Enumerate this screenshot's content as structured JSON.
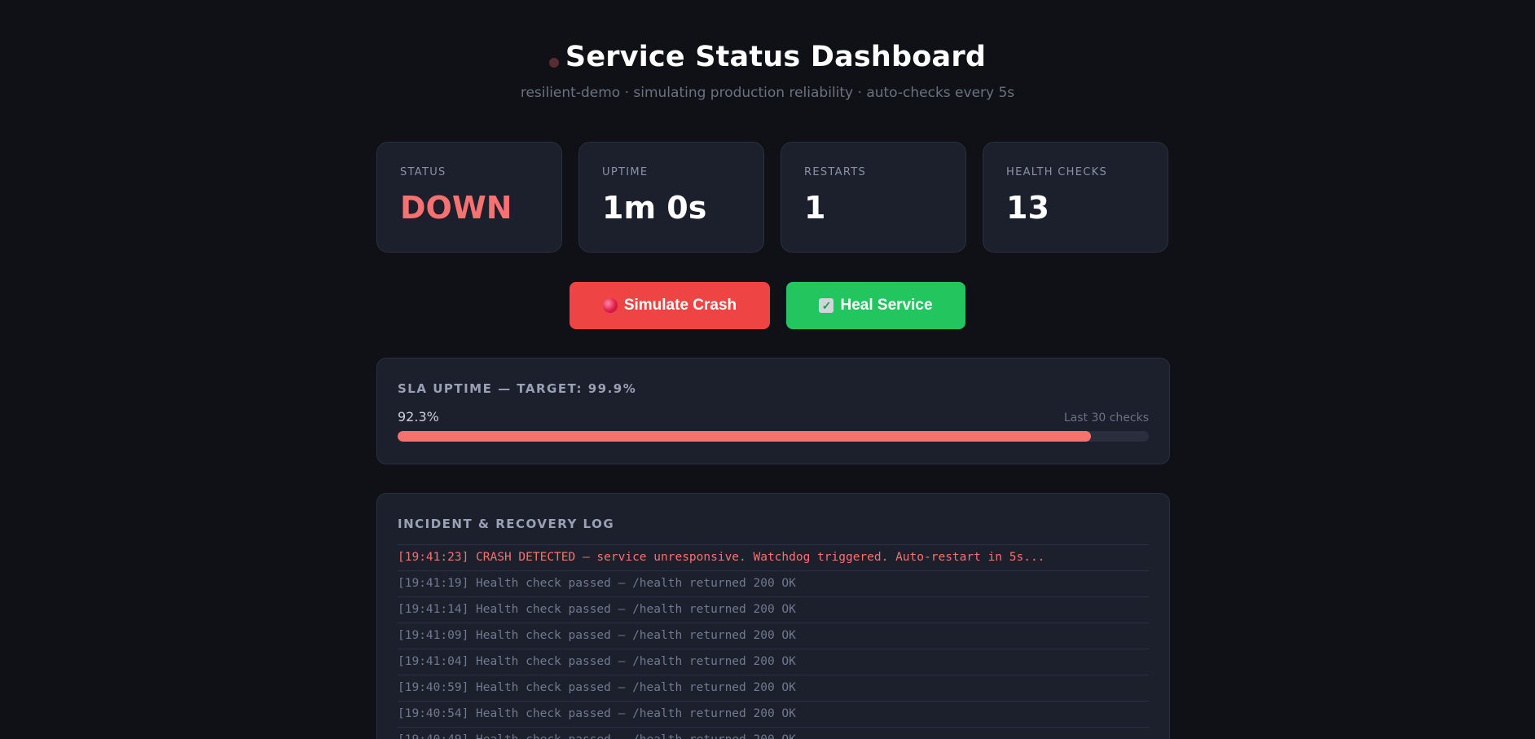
{
  "header": {
    "title": "Service Status Dashboard",
    "subtitle": "resilient-demo · simulating production reliability · auto-checks every 5s"
  },
  "stats": [
    {
      "label": "STATUS",
      "value": "DOWN"
    },
    {
      "label": "UPTIME",
      "value": "1m 0s"
    },
    {
      "label": "RESTARTS",
      "value": "1"
    },
    {
      "label": "HEALTH CHECKS",
      "value": "13"
    }
  ],
  "actions": {
    "crash_label": "Simulate Crash",
    "heal_label": "Heal Service"
  },
  "sla": {
    "title": "SLA UPTIME — TARGET: 99.9%",
    "percent_text": "92.3%",
    "percent_value": 92.3,
    "note": "Last 30 checks"
  },
  "log": {
    "title": "INCIDENT & RECOVERY LOG",
    "entries": [
      {
        "text": "[19:41:23] CRASH DETECTED — service unresponsive. Watchdog triggered. Auto-restart in 5s...",
        "level": "error"
      },
      {
        "text": "[19:41:19] Health check passed — /health returned 200 OK",
        "level": "info"
      },
      {
        "text": "[19:41:14] Health check passed — /health returned 200 OK",
        "level": "info"
      },
      {
        "text": "[19:41:09] Health check passed — /health returned 200 OK",
        "level": "info"
      },
      {
        "text": "[19:41:04] Health check passed — /health returned 200 OK",
        "level": "info"
      },
      {
        "text": "[19:40:59] Health check passed — /health returned 200 OK",
        "level": "info"
      },
      {
        "text": "[19:40:54] Health check passed — /health returned 200 OK",
        "level": "info"
      },
      {
        "text": "[19:40:49] Health check passed — /health returned 200 OK",
        "level": "info"
      }
    ]
  },
  "colors": {
    "background": "#0f1117",
    "card": "#1c1f2c",
    "down": "#f87171",
    "crash_button": "#ef4444",
    "heal_button": "#22c55e"
  },
  "icons": {
    "status": "status-dot-icon",
    "crash": "red-orb-icon",
    "heal": "check-box-icon"
  }
}
